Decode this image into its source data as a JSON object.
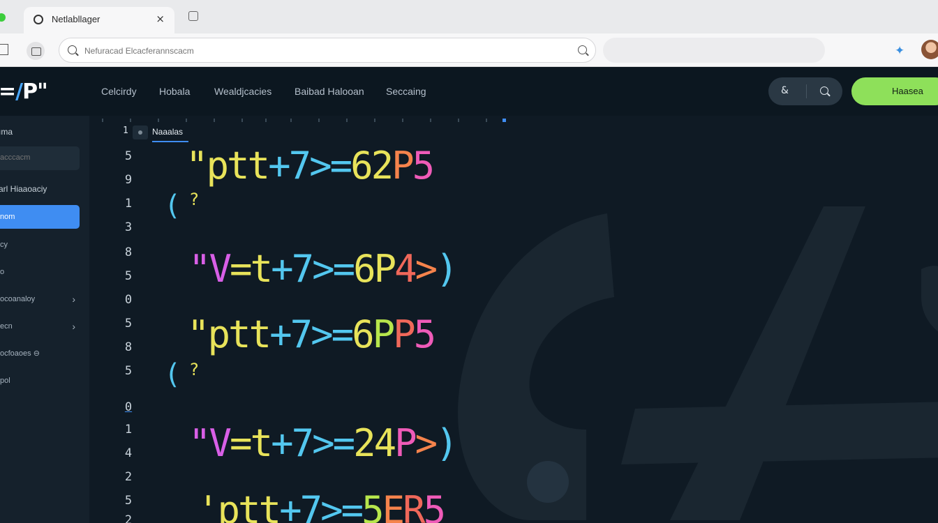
{
  "browser": {
    "tab_title": "Netlabllager",
    "tab_close": "×",
    "address_placeholder": "Nefuracad Elcacferannscacm"
  },
  "app": {
    "logo_main": "=",
    "logo_accent": "/",
    "logo_tail": "P\"",
    "nav": [
      "Celcirdy",
      "Hobala",
      "Wealdjcacies",
      "Baibad Halooan",
      "Seccaing"
    ],
    "nav_action_icon": "&",
    "cta_label": "Haasea"
  },
  "sidebar": {
    "heading": "ıma",
    "filter_placeholder": "acccacm",
    "subheading": "arl Hiaaoaciy",
    "items": [
      {
        "label": "nom",
        "active": true,
        "chevron": ""
      },
      {
        "label": "cy",
        "active": false,
        "chevron": ""
      },
      {
        "label": "o",
        "active": false,
        "chevron": ""
      },
      {
        "label": "ocoanaloy",
        "active": false,
        "chevron": "›"
      },
      {
        "label": "ecn",
        "active": false,
        "chevron": "›"
      },
      {
        "label": "ocfoaoes ⊖",
        "active": false,
        "chevron": ""
      },
      {
        "label": "pol",
        "active": false,
        "chevron": ""
      }
    ]
  },
  "editor": {
    "tab_number": "1",
    "file_name": "Naaalas",
    "gutter": [
      "5",
      "9",
      "1",
      "3",
      "8",
      "5",
      "0",
      "5",
      "8",
      "5",
      "0",
      "1",
      "4",
      "2",
      "5",
      "2"
    ],
    "code_lines": [
      {
        "parts": [
          [
            "\"p",
            "y"
          ],
          [
            "tt",
            "y"
          ],
          [
            "+7",
            "c"
          ],
          [
            ">=",
            "c"
          ],
          [
            "62",
            "y"
          ],
          [
            "P",
            "o"
          ],
          [
            "5",
            "p"
          ]
        ]
      },
      {
        "parts": [
          [
            "\"V",
            "m"
          ],
          [
            "=",
            "y"
          ],
          [
            "t",
            "y"
          ],
          [
            "+7",
            "c"
          ],
          [
            ">=",
            "c"
          ],
          [
            "6P",
            "y"
          ],
          [
            "4",
            "r"
          ],
          [
            ">",
            "o"
          ],
          [
            ")",
            "c"
          ]
        ]
      },
      {
        "parts": [
          [
            "\"p",
            "y"
          ],
          [
            "tt",
            "y"
          ],
          [
            "+7",
            "c"
          ],
          [
            ">=",
            "c"
          ],
          [
            "6",
            "y"
          ],
          [
            "P",
            "g"
          ],
          [
            "P",
            "r"
          ],
          [
            "5",
            "p"
          ]
        ]
      },
      {
        "parts": [
          [
            "\"V",
            "m"
          ],
          [
            "=",
            "y"
          ],
          [
            "t",
            "y"
          ],
          [
            "+7",
            "c"
          ],
          [
            ">=",
            "c"
          ],
          [
            "2",
            "y"
          ],
          [
            "4",
            "y"
          ],
          [
            "P",
            "p"
          ],
          [
            ">",
            "o"
          ],
          [
            ")",
            "c"
          ]
        ]
      },
      {
        "parts": [
          [
            "'p",
            "y"
          ],
          [
            "tt",
            "y"
          ],
          [
            "+7",
            "c"
          ],
          [
            ">=",
            "c"
          ],
          [
            "5",
            "g"
          ],
          [
            "E",
            "o"
          ],
          [
            "R",
            "r"
          ],
          [
            "5",
            "p"
          ]
        ]
      }
    ],
    "paren_marks": [
      "(",
      "?",
      "(",
      "?"
    ]
  },
  "colors": {
    "yellow": "#e8e35a",
    "cyan": "#53c7ef",
    "green": "#b7e64c",
    "orange": "#f5834c",
    "pink": "#ef5bb8",
    "magenta": "#d85fe6",
    "red": "#f0685a",
    "accent": "#3f8df2",
    "cta": "#8ee05a"
  }
}
